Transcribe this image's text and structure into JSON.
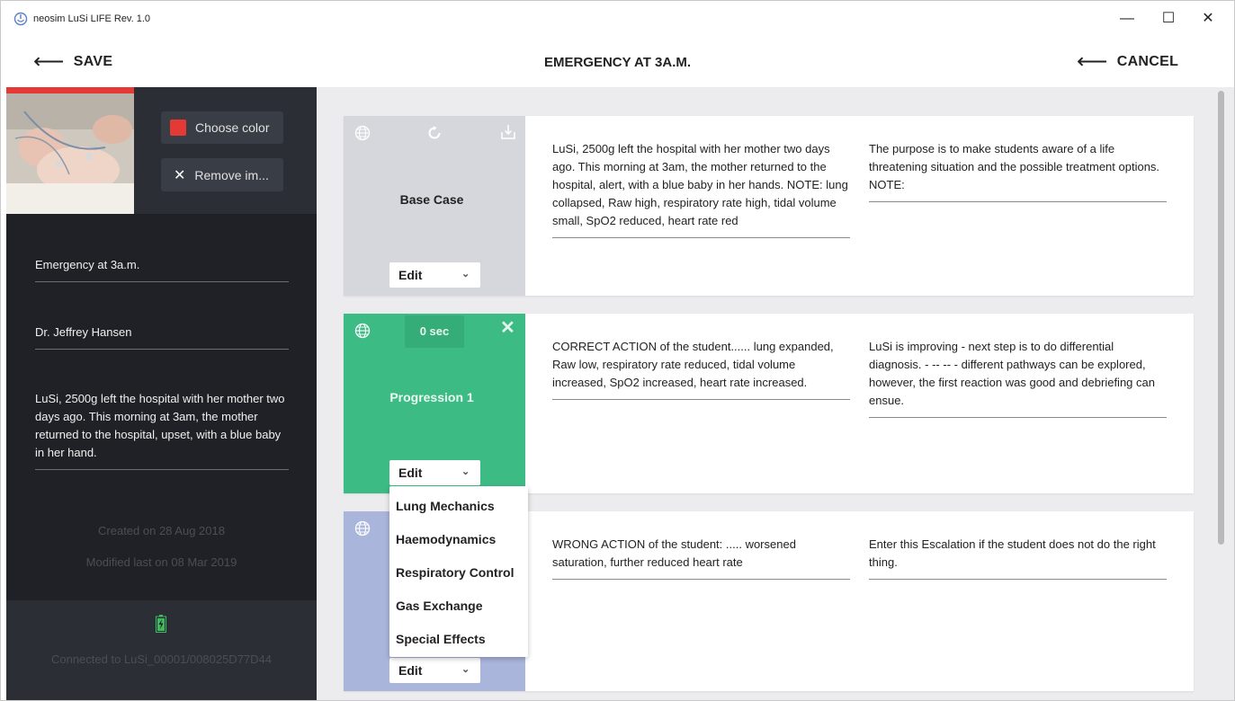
{
  "window": {
    "title": "neosim LuSi LIFE Rev. 1.0",
    "minimize": "—",
    "maximize": "☐",
    "close": "✕"
  },
  "header": {
    "save_label": "SAVE",
    "cancel_label": "CANCEL",
    "title": "EMERGENCY AT 3A.M.",
    "back_arrow": "⟵"
  },
  "sidebar": {
    "choose_color_label": "Choose color",
    "selected_color": "#e53935",
    "remove_image_label": "Remove im...",
    "scenario_name": "Emergency at 3a.m.",
    "author": "Dr. Jeffrey Hansen",
    "description": "LuSi, 2500g left the hospital with her mother two days ago. This morning at 3am, the mother returned to the hospital, upset, with a blue baby in her hand.",
    "created": "Created on 28 Aug 2018",
    "modified": "Modified last on 08 Mar 2019",
    "connected": "Connected to LuSi_00001/008025D77D44"
  },
  "cards": [
    {
      "name": "Base Case",
      "edit_label": "Edit",
      "color": "#d6d7dc",
      "text_a": "LuSi, 2500g left the hospital with her mother two days ago. This morning at 3am, the mother returned to the hospital, alert, with a blue baby in her hands. NOTE: lung collapsed, Raw high, respiratory rate high, tidal volume small, SpO2 reduced, heart rate red",
      "text_b": "The purpose is to make students aware of a life threatening situation and the possible treatment options. NOTE:"
    },
    {
      "name": "Progression 1",
      "timer": "0 sec",
      "edit_label": "Edit",
      "color": "#3dbb84",
      "text_a": "CORRECT ACTION of the student...... lung expanded, Raw low, respiratory rate reduced, tidal volume increased, SpO2 increased, heart rate increased.",
      "text_b": "LuSi is improving - next step is to do differential diagnosis. -  -- -- - different pathways can be explored, however, the first reaction was good and debriefing can ensue."
    },
    {
      "name": "",
      "edit_label": "Edit",
      "color": "#aab5dc",
      "text_a": "WRONG ACTION of the student: ..... worsened saturation, further reduced heart rate",
      "text_b": "Enter this Escalation if the student does not do the right thing."
    }
  ],
  "edit_menu": {
    "items": [
      "Lung Mechanics",
      "Haemodynamics",
      "Respiratory Control",
      "Gas Exchange",
      "Special Effects"
    ]
  }
}
